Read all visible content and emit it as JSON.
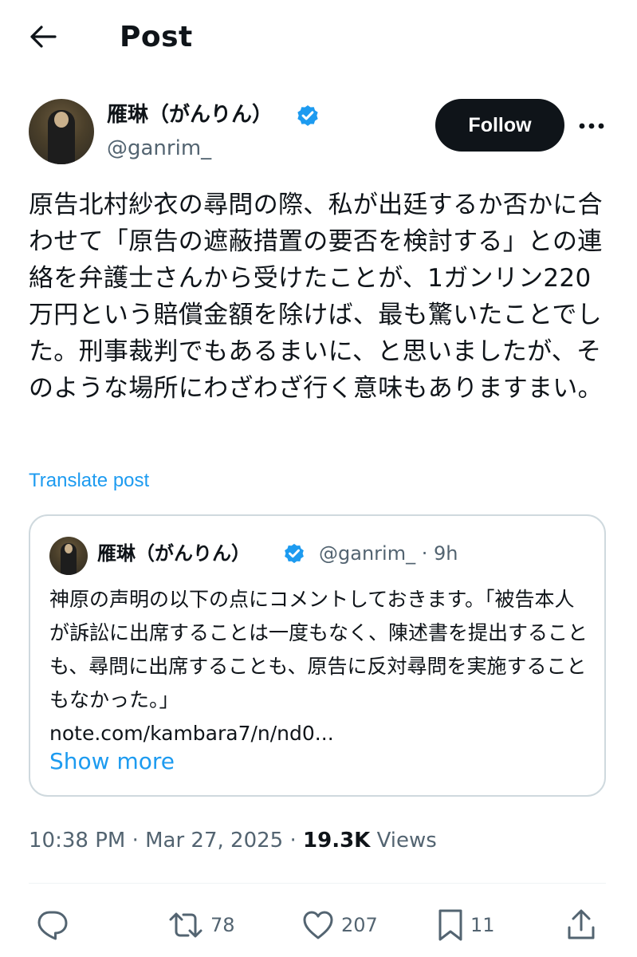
{
  "header": {
    "title": "Post"
  },
  "author": {
    "name": "雁琳（がんりん）",
    "handle": "@ganrim_",
    "follow_label": "Follow"
  },
  "post": {
    "text": "原告北村紗衣の尋問の際、私が出廷するか否かに合わせて「原告の遮蔽措置の要否を検討する」との連絡を弁護士さんから受けたことが、1ガンリン220万円という賠償金額を除けば、最も驚いたことでした。刑事裁判でもあるまいに、と思いましたが、そのような場所にわざわざ行く意味もありますまい。",
    "translate_label": "Translate post"
  },
  "quote": {
    "name": "雁琳（がんりん）",
    "handle": "@ganrim_",
    "separator": "·",
    "time": "9h",
    "text": "神原の声明の以下の点にコメントしておきます。「被告本人が訴訟に出席することは一度もなく、陳述書を提出することも、尋問に出席することも、原告に反対尋問を実施することもなかった。」",
    "link": "note.com/kambara7/n/nd0...",
    "show_more": "Show more"
  },
  "meta": {
    "time": "10:38 PM",
    "separator": "·",
    "date": "Mar 27, 2025",
    "separator2": "·",
    "views_count": "19.3K",
    "views_label": "Views"
  },
  "actions": {
    "reposts": "78",
    "likes": "207",
    "bookmarks": "11"
  },
  "colors": {
    "accent": "#1d9bf0",
    "text": "#0f1419",
    "secondary": "#536471",
    "border": "#cfd9de"
  }
}
